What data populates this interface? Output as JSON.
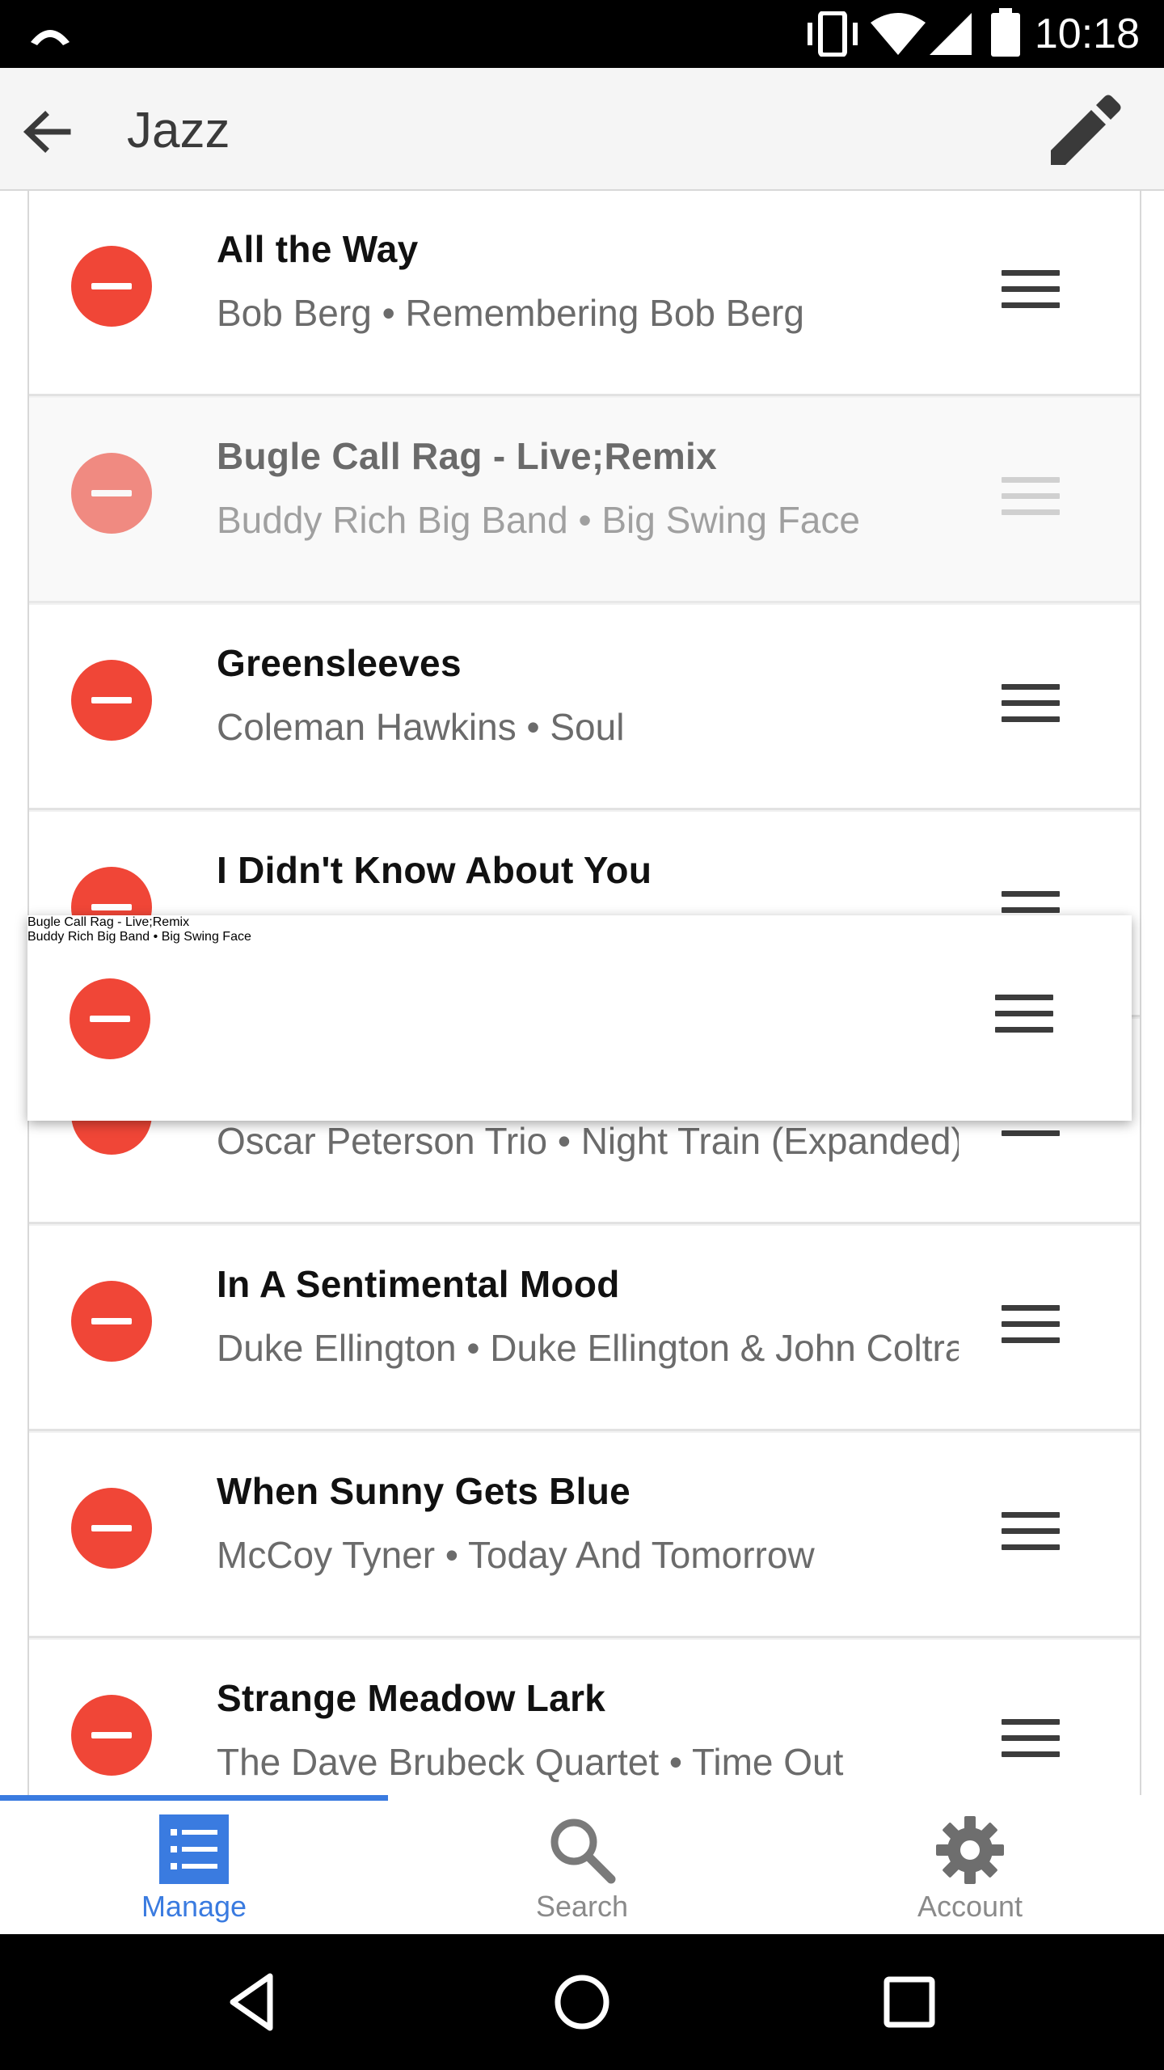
{
  "status_bar": {
    "time": "10:18"
  },
  "app_bar": {
    "title": "Jazz"
  },
  "playlist": {
    "items": [
      {
        "title": "All the Way",
        "subtitle": "Bob Berg • Remembering Bob Berg"
      },
      {
        "title": "Bugle Call Rag - Live;Remix",
        "subtitle": "Buddy Rich Big Band • Big Swing Face"
      },
      {
        "title": "Greensleeves",
        "subtitle": "Coleman Hawkins • Soul"
      },
      {
        "title": "I Didn't Know About You",
        "subtitle": ""
      },
      {
        "title": "",
        "subtitle": "Oscar Peterson Trio • Night Train (Expanded)"
      },
      {
        "title": "In A Sentimental Mood",
        "subtitle": "Duke Ellington • Duke Ellington & John Coltrane"
      },
      {
        "title": "When Sunny Gets Blue",
        "subtitle": "McCoy Tyner • Today And Tomorrow"
      },
      {
        "title": "Strange Meadow Lark",
        "subtitle": "The Dave Brubeck Quartet • Time Out"
      }
    ],
    "dragging": {
      "title": "Bugle Call Rag - Live;Remix",
      "subtitle": "Buddy Rich Big Band • Big Swing Face"
    }
  },
  "bottom_nav": {
    "items": [
      {
        "label": "Manage",
        "active": true
      },
      {
        "label": "Search",
        "active": false
      },
      {
        "label": "Account",
        "active": false
      }
    ]
  },
  "colors": {
    "remove_red": "#f04637",
    "accent_blue": "#3a7be0",
    "app_bar_bg": "#f5f5f5"
  },
  "icons": {
    "status": [
      "alert-icon",
      "vibrate-icon",
      "wifi-icon",
      "signal-icon",
      "battery-icon"
    ],
    "app_bar": [
      "back-arrow-icon",
      "edit-pencil-icon"
    ],
    "row": [
      "remove-icon",
      "drag-handle-icon"
    ],
    "nav": [
      "list-icon",
      "search-icon",
      "gear-icon"
    ],
    "system": [
      "back-triangle-icon",
      "home-circle-icon",
      "recents-square-icon"
    ]
  }
}
